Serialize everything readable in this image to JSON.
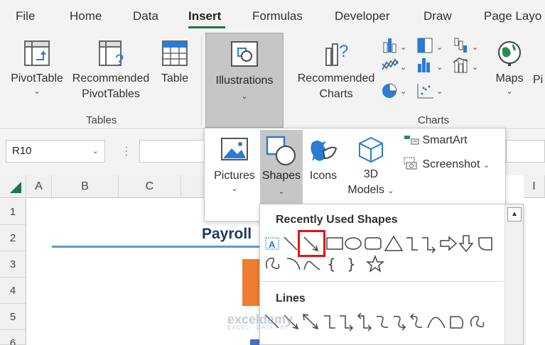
{
  "tabs": [
    "File",
    "Home",
    "Data",
    "Insert",
    "Formulas",
    "Developer",
    "Draw",
    "Page Layo"
  ],
  "ribbon": {
    "pivot_table": "PivotTable",
    "rec_pivot_1": "Recommended",
    "rec_pivot_2": "PivotTables",
    "table": "Table",
    "illustrations": "Illustrations",
    "rec_charts_1": "Recommended",
    "rec_charts_2": "Charts",
    "maps": "Maps",
    "pivot_chart_partial": "Pi",
    "group_tables": "Tables",
    "group_charts": "Charts",
    "chevron": "⌄"
  },
  "namebox": {
    "value": "R10"
  },
  "formula_icons": "⋮  ✕  ✓",
  "columns": [
    "A",
    "B",
    "C",
    "I"
  ],
  "rows": [
    "1",
    "2",
    "3",
    "4",
    "5",
    "6"
  ],
  "sheet": {
    "title": "Payroll"
  },
  "illustrations_menu": {
    "pictures": "Pictures",
    "shapes": "Shapes",
    "icons": "Icons",
    "models_1": "3D",
    "models_2": "Models",
    "smartart": "SmartArt",
    "screenshot": "Screenshot"
  },
  "shapes_gallery": {
    "recent_heading": "Recently Used Shapes",
    "lines_heading": "Lines"
  },
  "watermark": {
    "name": "exceldemy",
    "tagline": "EXCEL · DATA · BI"
  },
  "colors": {
    "accent_green": "#217346",
    "highlight_red": "#e1131a",
    "title_navy": "#1f3864"
  }
}
